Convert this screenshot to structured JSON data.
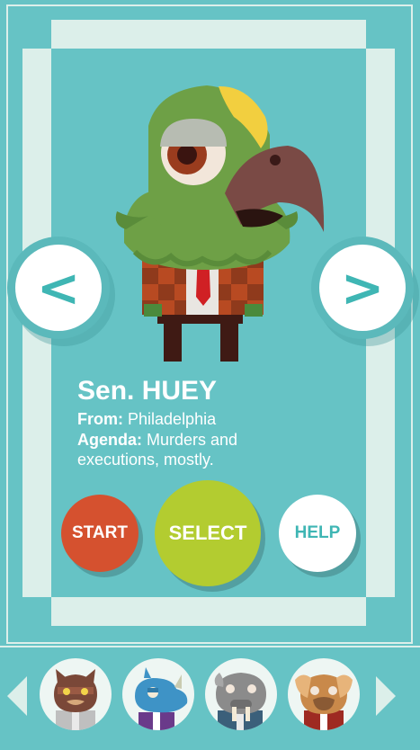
{
  "character": {
    "name": "Sen. HUEY",
    "from_label": "From:",
    "from_value": "Philadelphia",
    "agenda_label": "Agenda:",
    "agenda_value": "Murders and executions, mostly."
  },
  "nav": {
    "prev_label": "<",
    "next_label": ">"
  },
  "buttons": {
    "start": "START",
    "select": "SELECT",
    "help": "HELP"
  },
  "carousel": {
    "thumbnails": [
      "cat-senator-icon",
      "rhino-senator-icon",
      "walrus-senator-icon",
      "dog-senator-icon"
    ]
  },
  "colors": {
    "background": "#66c3c5",
    "frame": "#dcefea",
    "start": "#d5512f",
    "select": "#b3cc30",
    "help_text": "#3fb6b4"
  }
}
